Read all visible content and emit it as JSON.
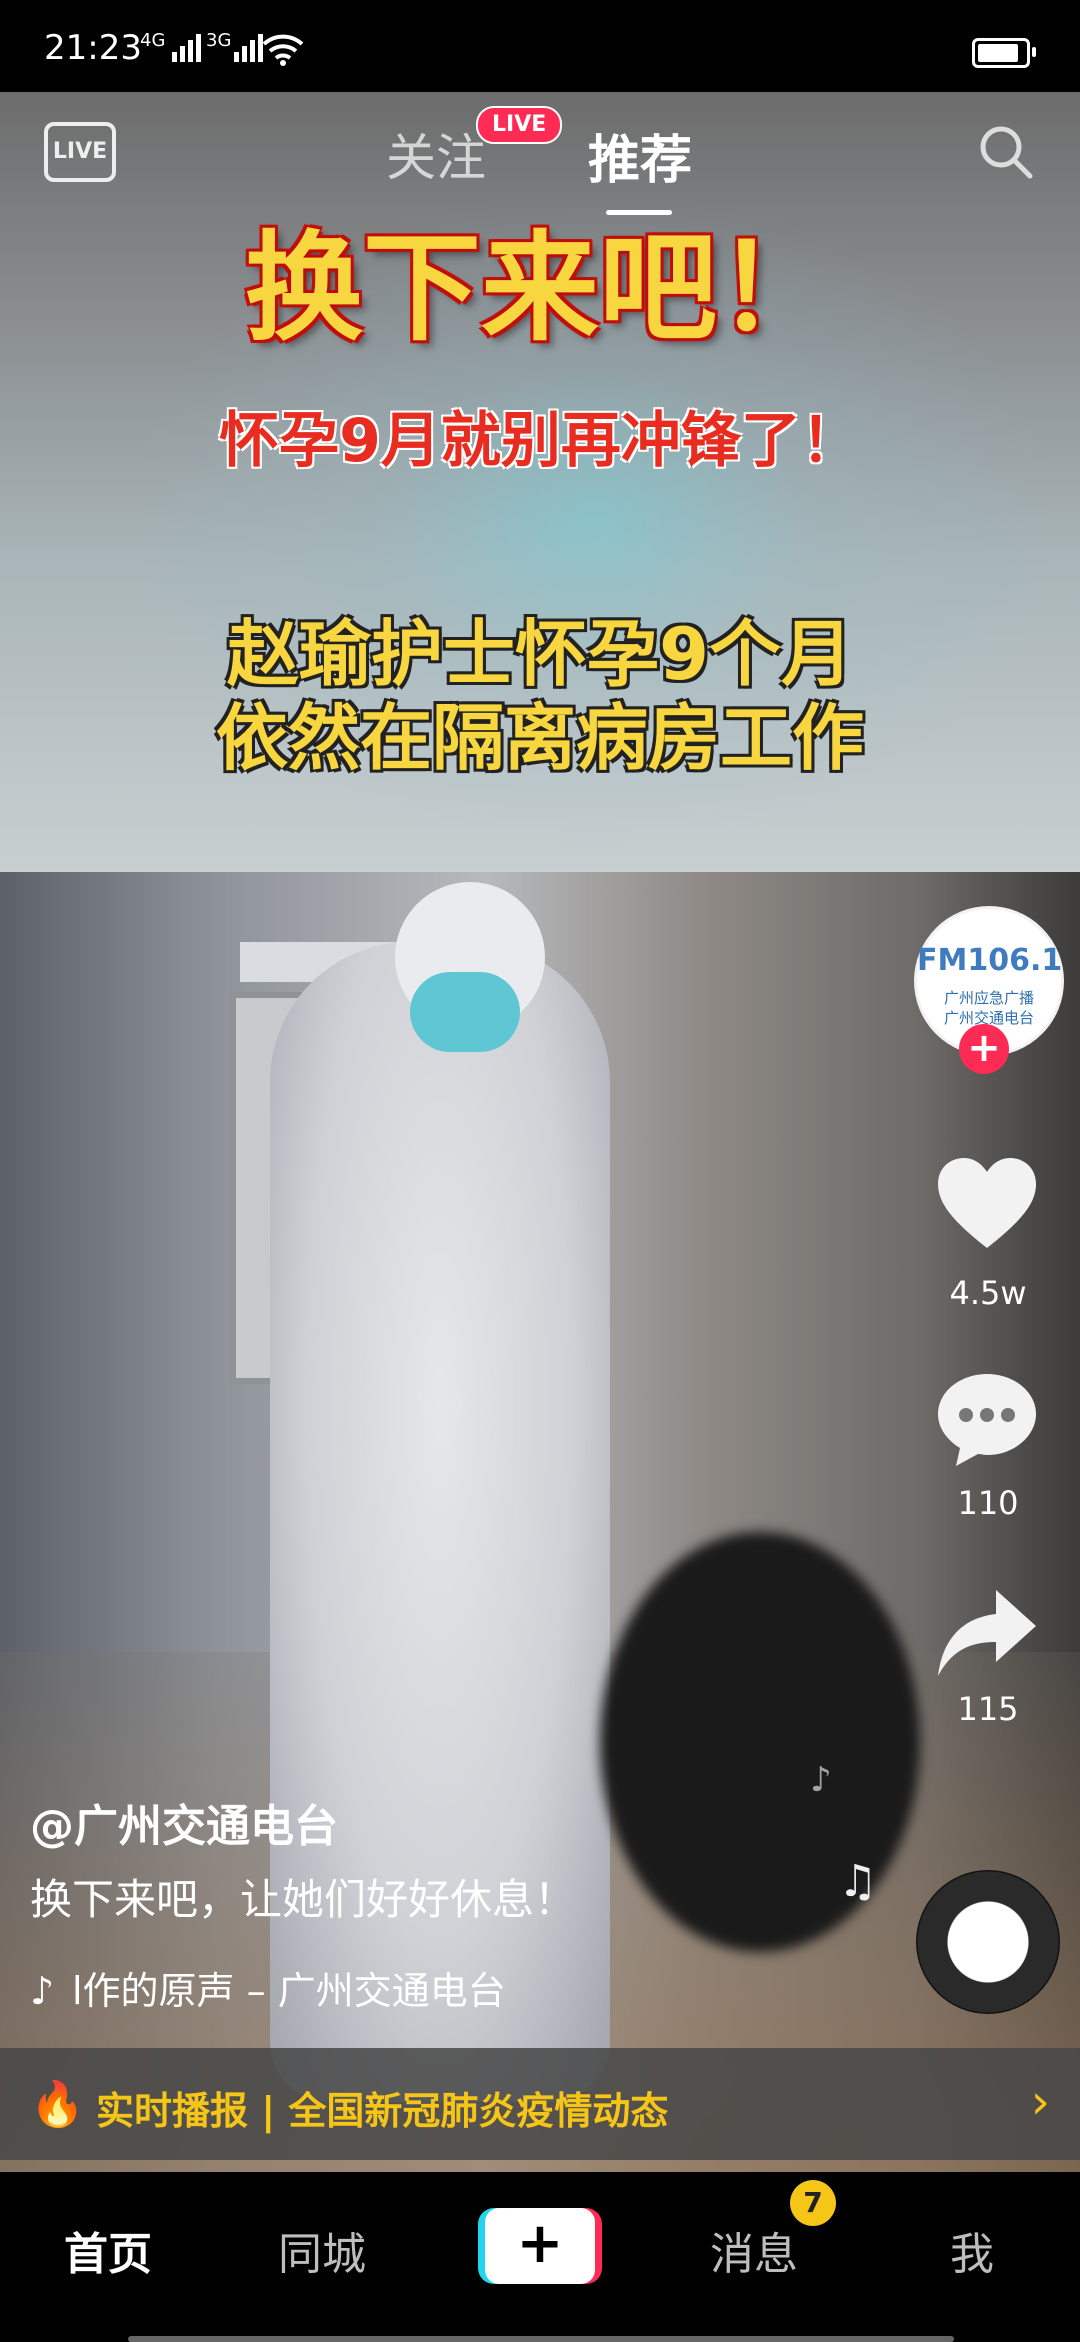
{
  "status_bar": {
    "time": "21:23",
    "net1": "4G",
    "net2": "3G"
  },
  "top_nav": {
    "live_icon_label": "LIVE",
    "tab_follow": "关注",
    "live_badge": "LIVE",
    "tab_recommend": "推荐"
  },
  "video": {
    "headline": "换下来吧！",
    "subheadline": "怀孕9月就别再冲锋了！",
    "caption_line1": "赵瑜护士怀孕9个月",
    "caption_line2": "依然在隔离病房工作"
  },
  "right_rail": {
    "avatar_title": "FM106.1",
    "avatar_sub1": "广州应急广播",
    "avatar_sub2": "广州交通电台",
    "likes": "4.5w",
    "comments": "110",
    "shares": "115"
  },
  "post": {
    "author": "@广州交通电台",
    "description": "换下来吧，让她们好好休息！",
    "music": "l作的原声 – 广州交通电台"
  },
  "banner": {
    "text": "实时播报 | 全国新冠肺炎疫情动态"
  },
  "bottom_nav": {
    "home": "首页",
    "city": "同城",
    "messages": "消息",
    "messages_badge": "7",
    "me": "我",
    "add": "+"
  },
  "colors": {
    "accent_red": "#fe2c55",
    "accent_cyan": "#20d5ec",
    "banner_yellow": "#f5c518"
  }
}
